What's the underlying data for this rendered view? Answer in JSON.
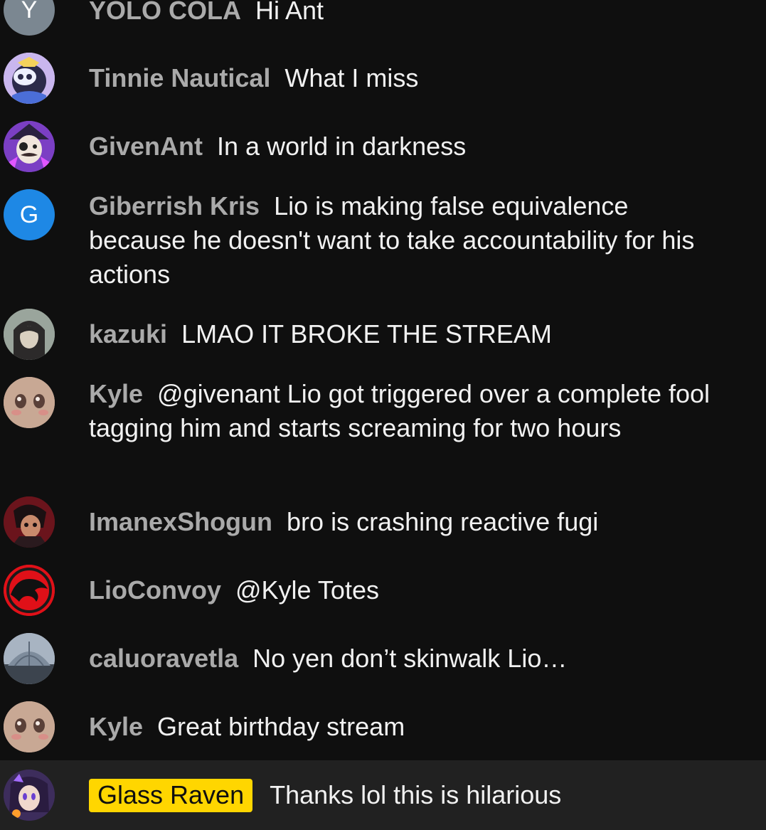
{
  "chat": {
    "messages": [
      {
        "author": "YOLO COLA",
        "text": "Hi Ant",
        "avatar": "letter-avatar-y",
        "avatar_letter": "Y",
        "avatar_color": "#7b8791"
      },
      {
        "author": "Tinnie Nautical",
        "text": "What I miss",
        "avatar": "character-avatar"
      },
      {
        "author": "GivenAnt",
        "text": "In a world in darkness",
        "avatar": "character-avatar"
      },
      {
        "author": "Giberrish Kris",
        "text": "Lio is making false equivalence because he doesn't want to take accountability for his actions",
        "avatar": "letter-avatar-g",
        "avatar_letter": "G",
        "avatar_color": "#1e88e5"
      },
      {
        "author": "kazuki",
        "text": "LMAO IT BROKE THE STREAM",
        "avatar": "photo-avatar"
      },
      {
        "author": "Kyle",
        "text": "@givenant Lio got triggered over a complete fool tagging him and starts screaming for two hours",
        "avatar": "face-avatar"
      },
      {
        "author": "ImanexShogun",
        "text": "bro is crashing reactive fugi",
        "avatar": "character-avatar"
      },
      {
        "author": "LioConvoy",
        "text": "@Kyle Totes",
        "avatar": "thundercats-logo-avatar"
      },
      {
        "author": "caluoravetla",
        "text": "No yen don’t skinwalk Lio…",
        "avatar": "dome-photo-avatar"
      },
      {
        "author": "Kyle",
        "text": "Great birthday stream",
        "avatar": "face-avatar"
      },
      {
        "author": "Glass Raven",
        "text": "Thanks lol this is hilarious",
        "avatar": "character-avatar",
        "owner": true,
        "highlight_color": "#ffd600"
      }
    ]
  }
}
